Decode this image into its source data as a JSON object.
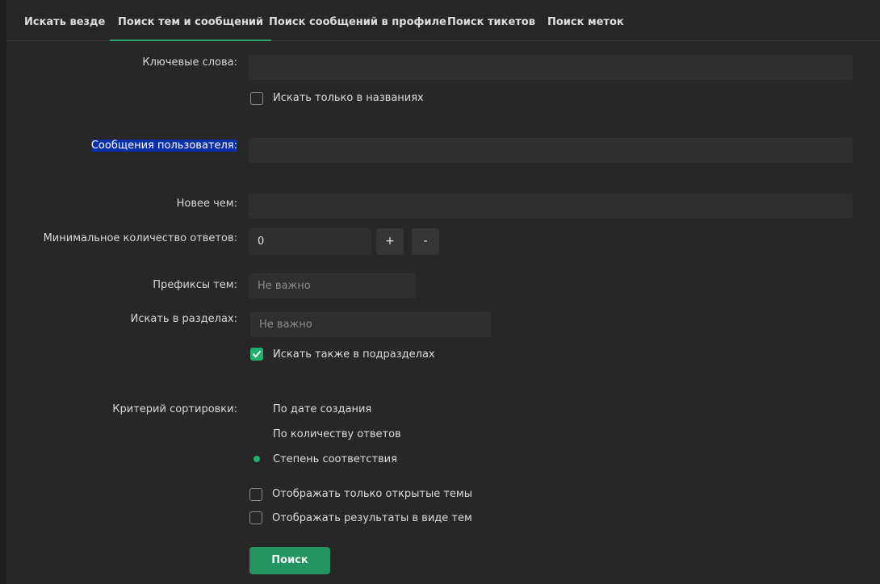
{
  "tabs": [
    {
      "label": "Искать везде"
    },
    {
      "label": "Поиск тем и сообщений",
      "active": true
    },
    {
      "label": "Поиск сообщений в профиле"
    },
    {
      "label": "Поиск тикетов"
    },
    {
      "label": "Поиск меток"
    }
  ],
  "form": {
    "keywords_label": "Ключевые слова:",
    "keywords_value": "",
    "titles_only_label": "Искать только в названиях",
    "titles_only_checked": false,
    "user_posts_label": "Сообщения пользователя:",
    "user_posts_value": "",
    "newer_than_label": "Новее чем:",
    "newer_than_value": "",
    "min_replies_label": "Минимальное количество ответов:",
    "min_replies_value": "0",
    "plus_label": "+",
    "minus_label": "-",
    "prefixes_label": "Префиксы тем:",
    "prefixes_value": "Не важно",
    "sections_label": "Искать в разделах:",
    "sections_value": "Не важно",
    "subsections_label": "Искать также в подразделах",
    "subsections_checked": true,
    "sort_label": "Критерий сортировки:",
    "sort_options": [
      {
        "label": "По дате создания",
        "selected": false
      },
      {
        "label": "По количеству ответов",
        "selected": false
      },
      {
        "label": "Степень соответствия",
        "selected": true
      }
    ],
    "open_only_label": "Отображать только открытые темы",
    "open_only_checked": false,
    "as_threads_label": "Отображать результаты в виде тем",
    "as_threads_checked": false,
    "submit_label": "Поиск"
  },
  "colors": {
    "accent": "#22b06f",
    "background": "#272727",
    "input": "#2f2f2f",
    "highlight": "#0b2fa8"
  }
}
